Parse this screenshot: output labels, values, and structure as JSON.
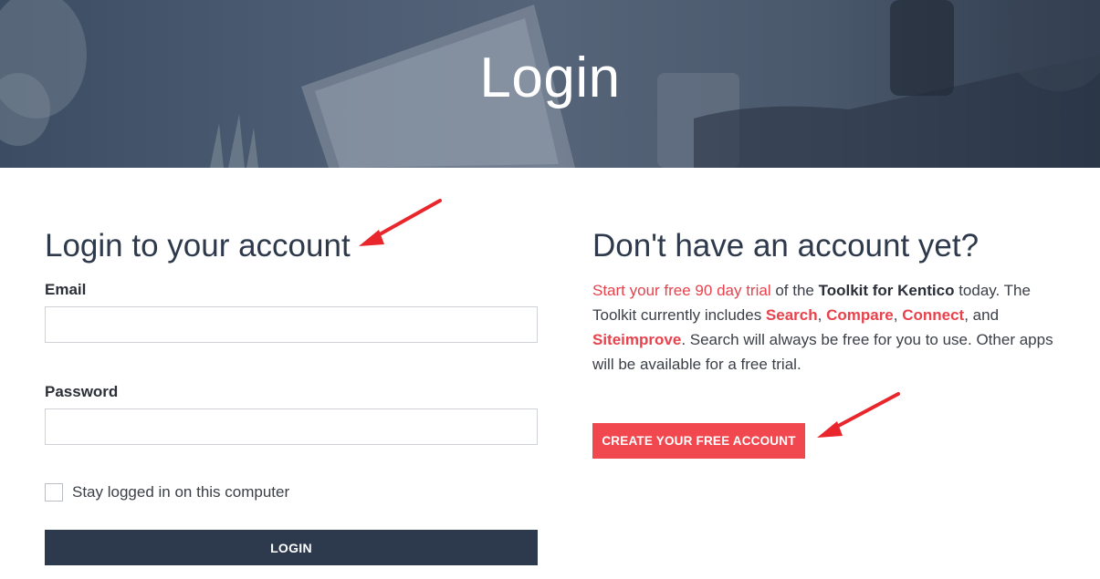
{
  "hero": {
    "title": "Login"
  },
  "login_form": {
    "heading": "Login to your account",
    "email_label": "Email",
    "email_value": "",
    "password_label": "Password",
    "password_value": "",
    "stay_logged_in_label": "Stay logged in on this computer",
    "stay_logged_in_checked": false,
    "login_button": "LOGIN"
  },
  "signup": {
    "heading": "Don't have an account yet?",
    "trial_link": "Start your free 90 day trial",
    "text_1": " of the ",
    "product": "Toolkit for Kentico",
    "text_2": " today. The Toolkit currently includes ",
    "app_search": "Search",
    "sep_1": ", ",
    "app_compare": "Compare",
    "sep_2": ", ",
    "app_connect": "Connect",
    "sep_3": ", and ",
    "app_siteimprove": "Siteimprove",
    "text_3": ". Search will always be free for you to use. Other apps will be available for a free trial.",
    "create_button": "CREATE YOUR FREE ACCOUNT"
  },
  "colors": {
    "accent": "#f0484e",
    "link": "#e8424c",
    "primary_dark": "#2d3a4e",
    "annotation_arrow": "#e8262b"
  },
  "annotations": [
    "red-arrow-icon",
    "red-arrow-icon"
  ]
}
